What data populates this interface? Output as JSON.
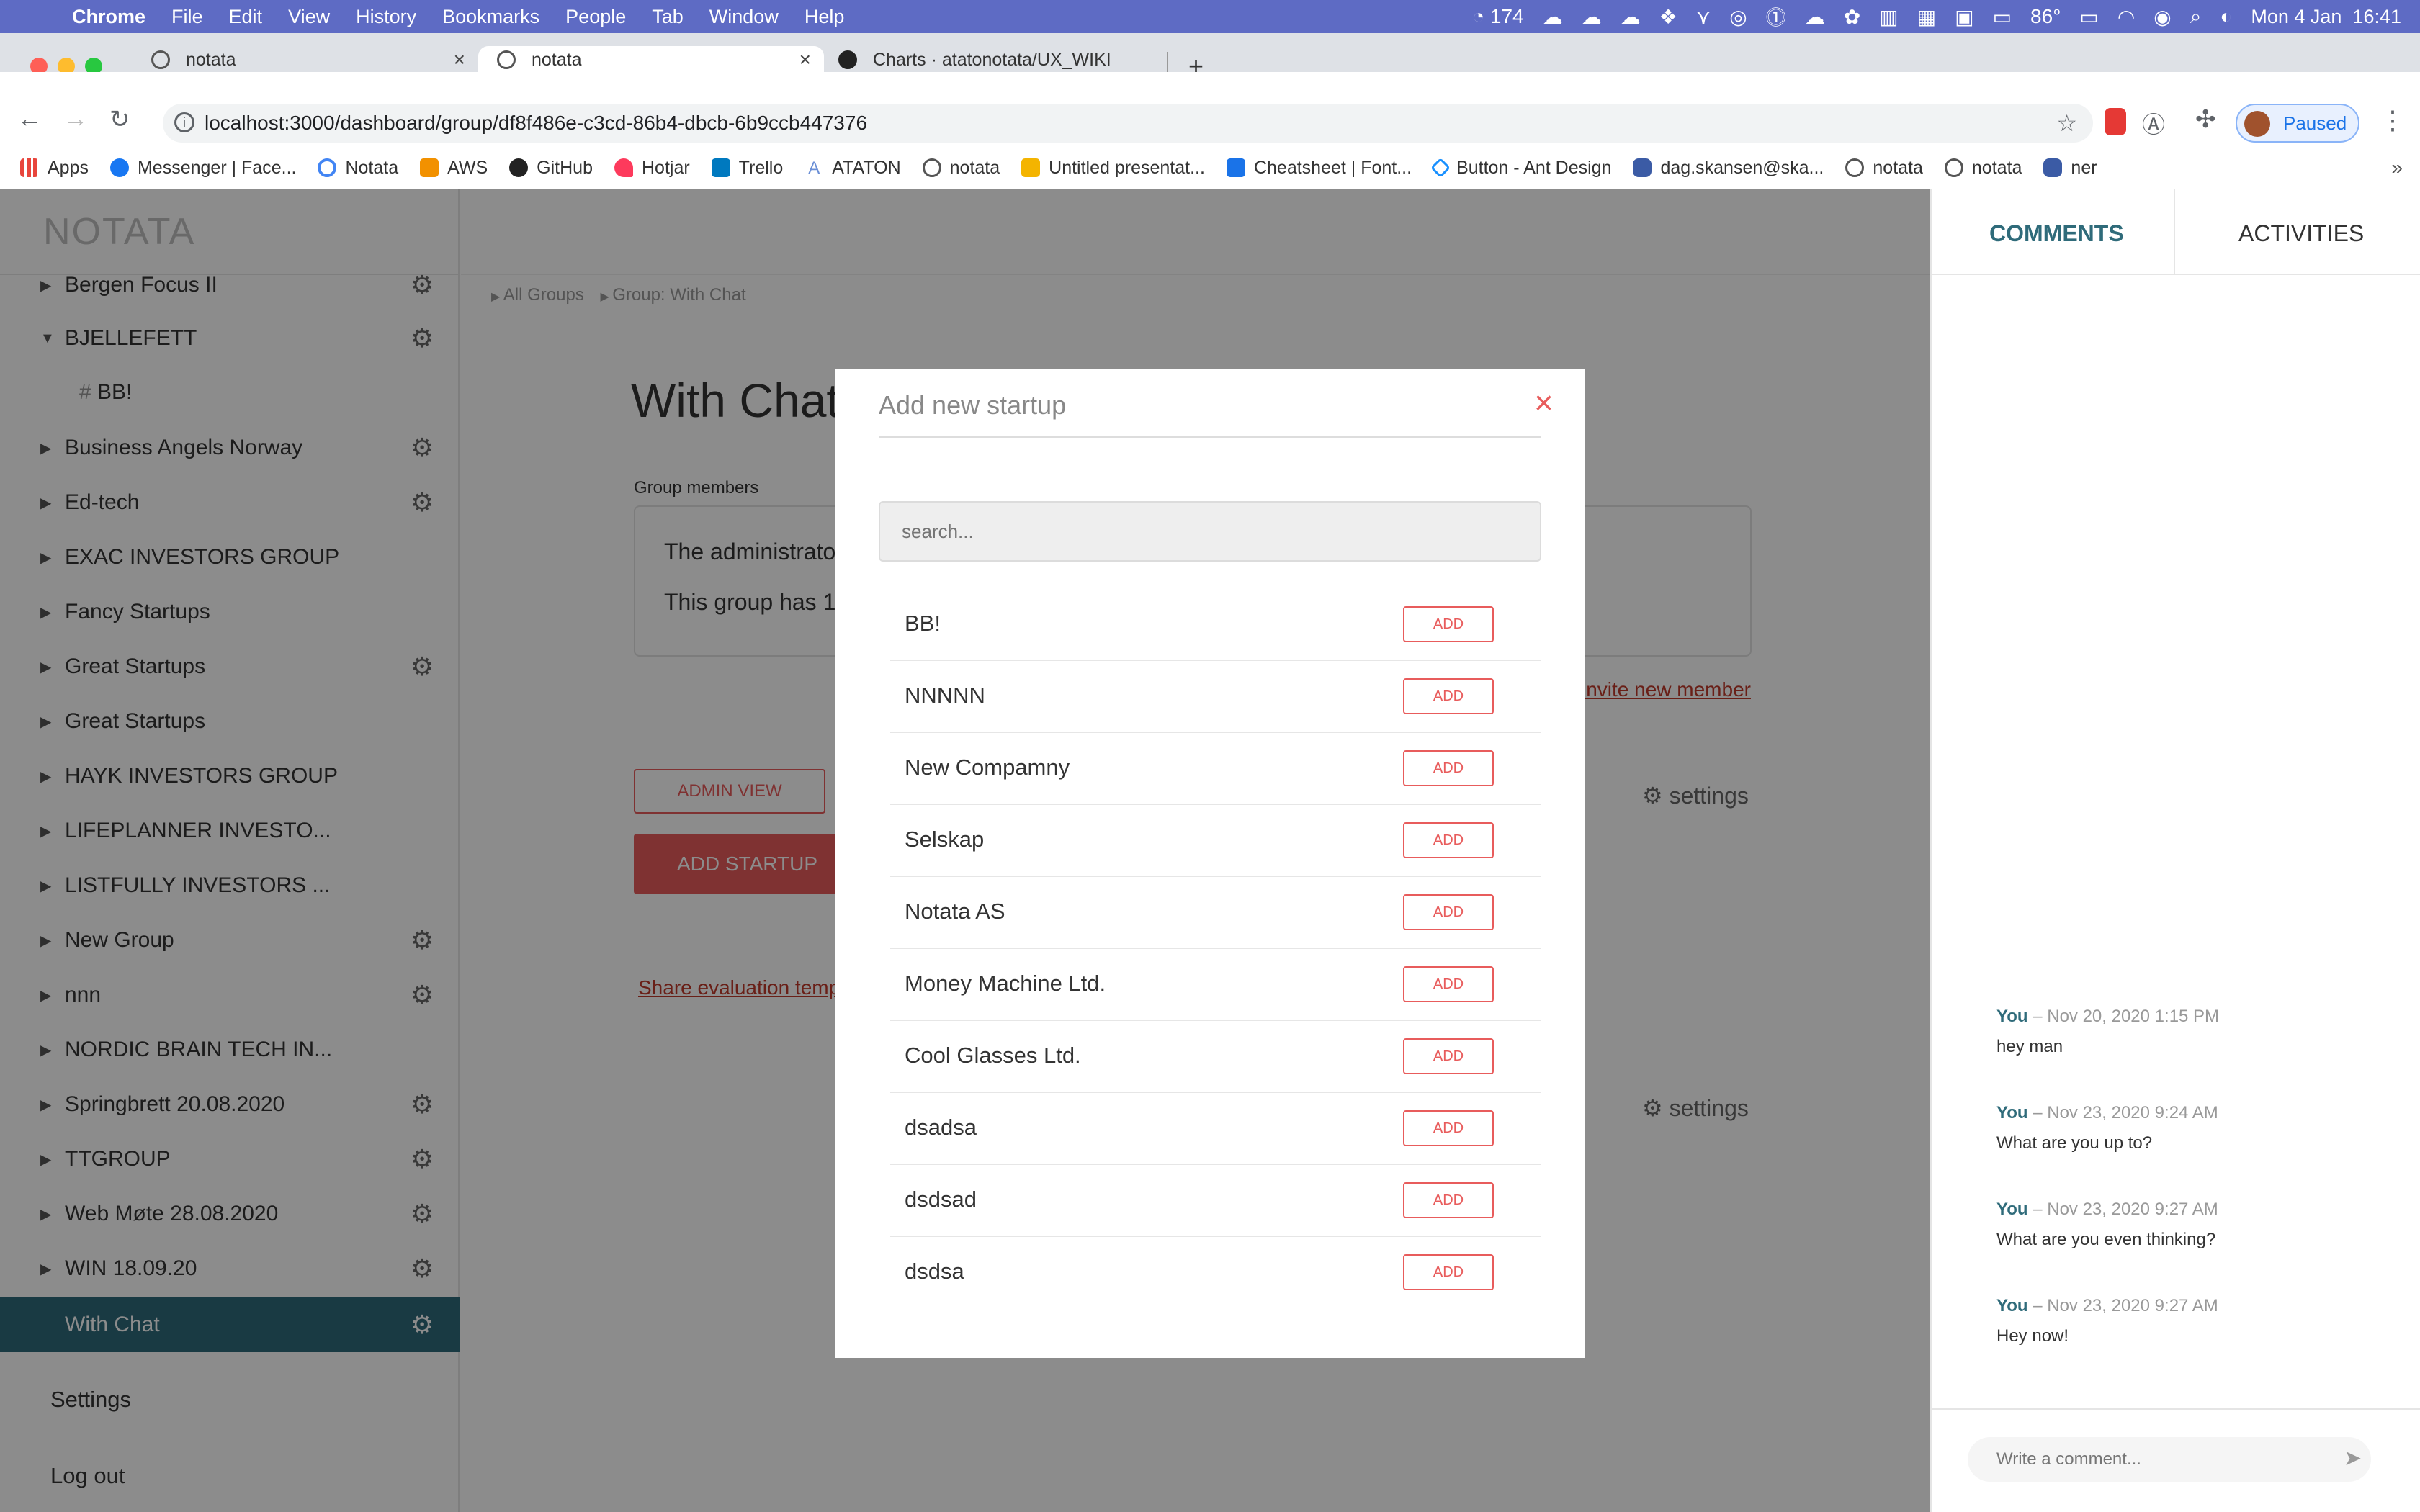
{
  "menubar": {
    "app": "Chrome",
    "items": [
      "File",
      "Edit",
      "View",
      "History",
      "Bookmarks",
      "People",
      "Tab",
      "Window",
      "Help"
    ],
    "status_count": "174",
    "temperature": "86°",
    "datetime": "Mon 4 Jan  16:41"
  },
  "browser": {
    "tabs": [
      {
        "title": "notata",
        "active": false
      },
      {
        "title": "notata",
        "active": true
      },
      {
        "title": "Charts · atatonotata/UX_WIKI",
        "active": false
      }
    ],
    "url": "localhost:3000/dashboard/group/df8f486e-c3cd-86b4-dbcb-6b9ccb447376",
    "profile_status": "Paused",
    "bookmarks": [
      {
        "label": "Apps",
        "icon": "apps-grid-icon",
        "color": "#e8453c"
      },
      {
        "label": "Messenger | Face...",
        "icon": "facebook-icon",
        "color": "#1877f2"
      },
      {
        "label": "Notata",
        "icon": "google-icon",
        "color": "#4285f4"
      },
      {
        "label": "AWS",
        "icon": "aws-icon",
        "color": "#f29100"
      },
      {
        "label": "GitHub",
        "icon": "github-icon",
        "color": "#222222"
      },
      {
        "label": "Hotjar",
        "icon": "hotjar-icon",
        "color": "#fd3a5c"
      },
      {
        "label": "Trello",
        "icon": "trello-icon",
        "color": "#0079bf"
      },
      {
        "label": "ATATON",
        "icon": "ataton-icon",
        "color": "#6b8fd6"
      },
      {
        "label": "notata",
        "icon": "globe-icon",
        "color": "#555555"
      },
      {
        "label": "Untitled presentat...",
        "icon": "slides-icon",
        "color": "#f4b400"
      },
      {
        "label": "Cheatsheet | Font...",
        "icon": "flag-icon",
        "color": "#1a73e8"
      },
      {
        "label": "Button - Ant Design",
        "icon": "ant-design-icon",
        "color": "#1890ff"
      },
      {
        "label": "dag.skansen@ska...",
        "icon": "database-icon",
        "color": "#3b5ba5"
      },
      {
        "label": "notata",
        "icon": "globe-icon",
        "color": "#555555"
      },
      {
        "label": "notata",
        "icon": "globe-icon",
        "color": "#555555"
      },
      {
        "label": "ner",
        "icon": "database-icon",
        "color": "#3b5ba5"
      }
    ]
  },
  "sidebar": {
    "logo": "NOTATA",
    "items": [
      {
        "label": "Bergen Focus II",
        "gear": true,
        "expanded": false
      },
      {
        "label": "BJELLEFETT",
        "gear": true,
        "expanded": true
      },
      {
        "label": "Business Angels Norway",
        "gear": true,
        "expanded": false
      },
      {
        "label": "Ed-tech",
        "gear": true,
        "expanded": false
      },
      {
        "label": "EXAC INVESTORS GROUP",
        "gear": false,
        "expanded": false
      },
      {
        "label": "Fancy Startups",
        "gear": false,
        "expanded": false
      },
      {
        "label": "Great Startups",
        "gear": true,
        "expanded": false
      },
      {
        "label": "Great Startups",
        "gear": false,
        "expanded": false
      },
      {
        "label": "HAYK INVESTORS GROUP",
        "gear": false,
        "expanded": false
      },
      {
        "label": "LIFEPLANNER INVESTO...",
        "gear": false,
        "expanded": false
      },
      {
        "label": "LISTFULLY INVESTORS ...",
        "gear": false,
        "expanded": false
      },
      {
        "label": "New Group",
        "gear": true,
        "expanded": false
      },
      {
        "label": "nnn",
        "gear": true,
        "expanded": false
      },
      {
        "label": "NORDIC BRAIN TECH IN...",
        "gear": false,
        "expanded": false
      },
      {
        "label": "Springbrett 20.08.2020",
        "gear": true,
        "expanded": false
      },
      {
        "label": "TTGROUP",
        "gear": true,
        "expanded": false
      },
      {
        "label": "Web Møte 28.08.2020",
        "gear": true,
        "expanded": false
      },
      {
        "label": "WIN 18.09.20",
        "gear": true,
        "expanded": false
      },
      {
        "label": "With Chat",
        "gear": true,
        "expanded": false,
        "active": true
      }
    ],
    "subchannel": "BB!",
    "settings": "Settings",
    "logout": "Log out"
  },
  "main": {
    "breadcrumb": [
      "All Groups",
      "Group: With Chat"
    ],
    "title": "With Chat",
    "members_label": "Group members",
    "members_line1": "The administrato",
    "members_line2": "This group has 1",
    "invite_link": "invite new member",
    "admin_view": "ADMIN VIEW",
    "add_startup": "ADD STARTUP",
    "settings_label": "settings",
    "share_link": "Share evaluation templ"
  },
  "right_panel": {
    "tabs": [
      "COMMENTS",
      "ACTIVITIES"
    ],
    "active_tab": "COMMENTS",
    "comments": [
      {
        "author": "You",
        "time": "Nov 20, 2020 1:15 PM",
        "text": "hey man"
      },
      {
        "author": "You",
        "time": "Nov 23, 2020 9:24 AM",
        "text": "What are you up to?"
      },
      {
        "author": "You",
        "time": "Nov 23, 2020 9:27 AM",
        "text": "What are you even thinking?"
      },
      {
        "author": "You",
        "time": "Nov 23, 2020 9:27 AM",
        "text": "Hey now!"
      }
    ],
    "input_placeholder": "Write a comment..."
  },
  "modal": {
    "title": "Add new startup",
    "search_placeholder": "search...",
    "add_label": "ADD",
    "startups": [
      "BB!",
      "NNNNN",
      "New Compamny",
      "Selskap",
      "Notata AS",
      "Money Machine Ltd.",
      "Cool Glasses Ltd.",
      "dsadsa",
      "dsdsad",
      "dsdsa"
    ]
  },
  "colors": {
    "accent": "#e85c5c",
    "active_item": "#2f6b7a",
    "menubar": "#5e6bc4"
  }
}
